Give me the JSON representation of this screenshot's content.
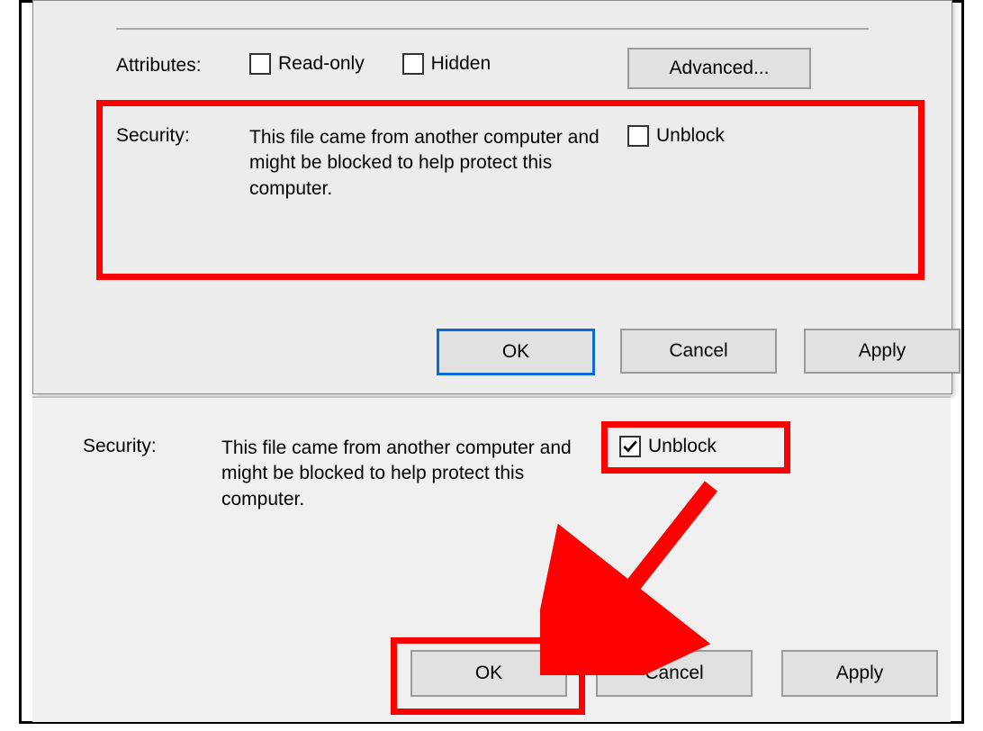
{
  "upper": {
    "attributes_label": "Attributes:",
    "readonly_label": "Read-only",
    "readonly_checked": false,
    "hidden_label": "Hidden",
    "hidden_checked": false,
    "advanced_label": "Advanced...",
    "security_label": "Security:",
    "security_text": "This file came from another computer and might be blocked to help protect this computer.",
    "unblock_label": "Unblock",
    "unblock_checked": false
  },
  "lower": {
    "security_label": "Security:",
    "security_text": "This file came from another computer and might be blocked to help protect this computer.",
    "unblock_label": "Unblock",
    "unblock_checked": true
  },
  "buttons": {
    "ok": "OK",
    "cancel": "Cancel",
    "apply": "Apply"
  },
  "annotations": {
    "highlight_color": "#ff0000",
    "highlights": [
      "security-section",
      "unblock-checkbox-checked",
      "ok-button"
    ],
    "arrow": {
      "from": "unblock-checkbox-checked",
      "to": "ok-button"
    }
  }
}
